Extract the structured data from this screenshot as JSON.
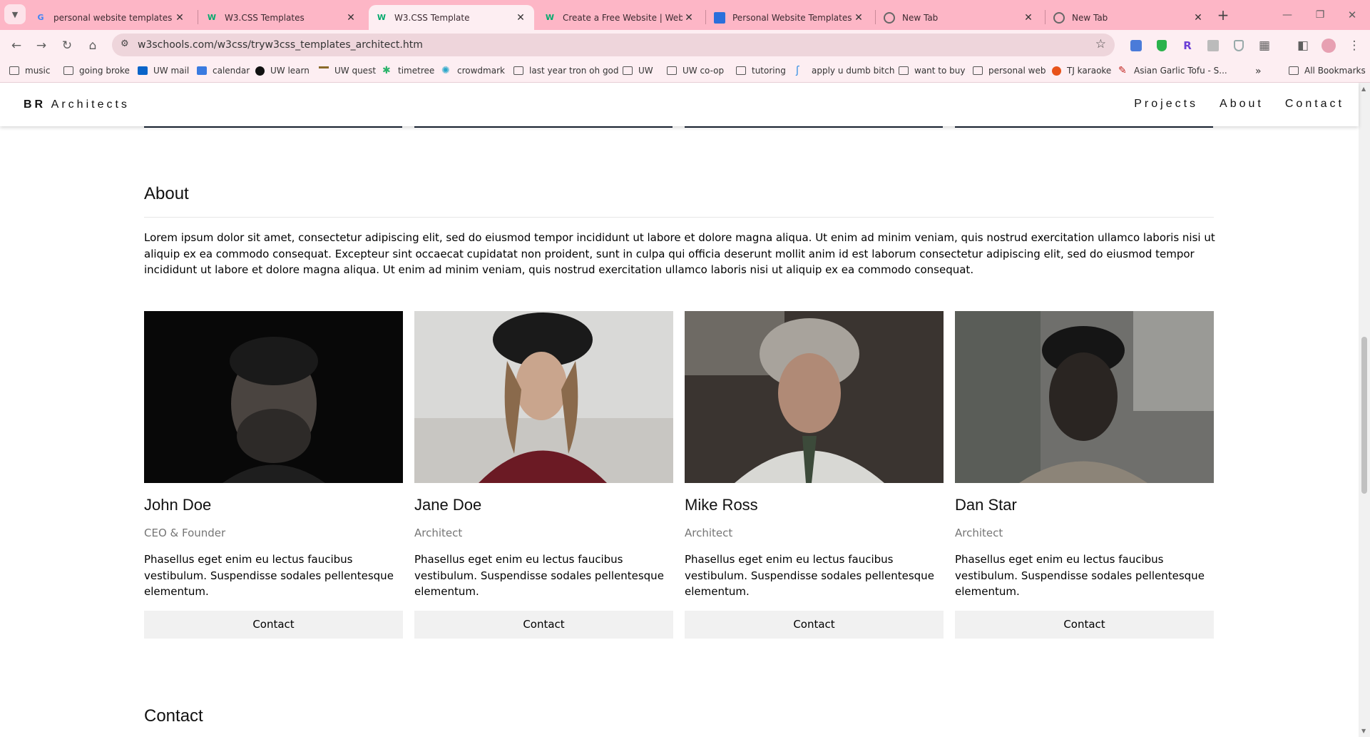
{
  "browser": {
    "tabs": [
      {
        "title": "personal website templates htm",
        "favicon": "google-icon",
        "active": false
      },
      {
        "title": "W3.CSS Templates",
        "favicon": "w3schools-icon",
        "active": false
      },
      {
        "title": "W3.CSS Template",
        "favicon": "w3schools-icon",
        "active": true
      },
      {
        "title": "Create a Free Website | Website",
        "favicon": "w3schools-icon",
        "active": false
      },
      {
        "title": "Personal Website Templates Fre",
        "favicon": "site-icon",
        "active": false
      },
      {
        "title": "New Tab",
        "favicon": "chrome-icon",
        "active": false
      },
      {
        "title": "New Tab",
        "favicon": "chrome-icon",
        "active": false
      }
    ],
    "url": "w3schools.com/w3css/tryw3css_templates_architect.htm",
    "bookmarks": [
      {
        "label": "music",
        "icon": "folder-icon"
      },
      {
        "label": "going broke",
        "icon": "folder-icon"
      },
      {
        "label": "UW mail",
        "icon": "outlook-icon"
      },
      {
        "label": "calendar",
        "icon": "calendar-icon"
      },
      {
        "label": "UW learn",
        "icon": "learn-icon"
      },
      {
        "label": "UW quest",
        "icon": "quest-icon"
      },
      {
        "label": "timetree",
        "icon": "timetree-icon"
      },
      {
        "label": "crowdmark",
        "icon": "crowdmark-icon"
      },
      {
        "label": "last year tron oh god",
        "icon": "folder-icon"
      },
      {
        "label": "UW",
        "icon": "folder-icon"
      },
      {
        "label": "UW co-op",
        "icon": "folder-icon"
      },
      {
        "label": "tutoring",
        "icon": "folder-icon"
      },
      {
        "label": "apply u dumb bitch",
        "icon": "apply-icon"
      },
      {
        "label": "want to buy",
        "icon": "folder-icon"
      },
      {
        "label": "personal web",
        "icon": "folder-icon"
      },
      {
        "label": "TJ karaoke",
        "icon": "karaoke-icon"
      },
      {
        "label": "Asian Garlic Tofu - S...",
        "icon": "recipe-icon"
      }
    ],
    "all_bookmarks": "All Bookmarks"
  },
  "site": {
    "brand_bold": "BR",
    "brand_rest": " Architects",
    "nav": [
      "Projects",
      "About",
      "Contact"
    ],
    "about_heading": "About",
    "about_text": "Lorem ipsum dolor sit amet, consectetur adipiscing elit, sed do eiusmod tempor incididunt ut labore et dolore magna aliqua. Ut enim ad minim veniam, quis nostrud exercitation ullamco laboris nisi ut aliquip ex ea commodo consequat. Excepteur sint occaecat cupidatat non proident, sunt in culpa qui officia deserunt mollit anim id est laborum consectetur adipiscing elit, sed do eiusmod tempor incididunt ut labore et dolore magna aliqua. Ut enim ad minim veniam, quis nostrud exercitation ullamco laboris nisi ut aliquip ex ea commodo consequat.",
    "team": [
      {
        "name": "John Doe",
        "role": "CEO & Founder",
        "desc": "Phasellus eget enim eu lectus faucibus vestibulum. Suspendisse sodales pellentesque elementum.",
        "button": "Contact"
      },
      {
        "name": "Jane Doe",
        "role": "Architect",
        "desc": "Phasellus eget enim eu lectus faucibus vestibulum. Suspendisse sodales pellentesque elementum.",
        "button": "Contact"
      },
      {
        "name": "Mike Ross",
        "role": "Architect",
        "desc": "Phasellus eget enim eu lectus faucibus vestibulum. Suspendisse sodales pellentesque elementum.",
        "button": "Contact"
      },
      {
        "name": "Dan Star",
        "role": "Architect",
        "desc": "Phasellus eget enim eu lectus faucibus vestibulum. Suspendisse sodales pellentesque elementum.",
        "button": "Contact"
      }
    ],
    "contact_heading": "Contact"
  }
}
